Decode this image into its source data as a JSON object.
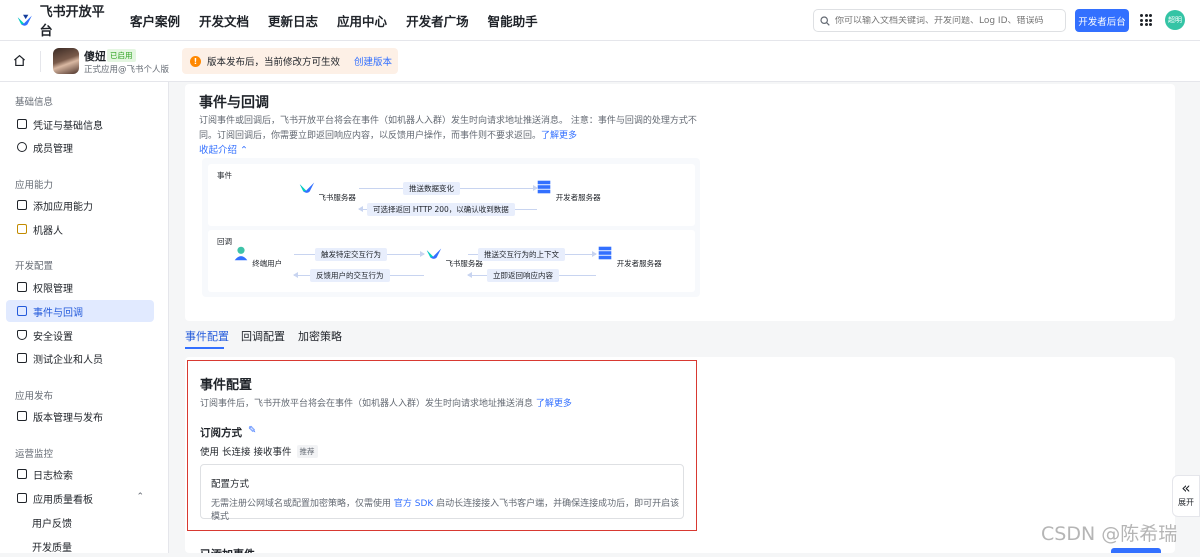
{
  "topnav": {
    "logo_text": "飞书开放平台",
    "links": [
      "客户案例",
      "开发文档",
      "更新日志",
      "应用中心",
      "开发者广场",
      "智能助手"
    ],
    "search_placeholder": "你可以输入文档关键词、开发问题、Log ID、错误码",
    "dev_button": "开发者后台",
    "avatar_text": "超明"
  },
  "app": {
    "name": "傻妞",
    "status": "已启用",
    "subtitle": "正式应用@飞书个人版"
  },
  "notice": {
    "text": "版本发布后，当前修改方可生效",
    "link": "创建版本"
  },
  "sidebar": {
    "sections": [
      {
        "title": "基础信息",
        "items": [
          {
            "label": "凭证与基础信息"
          },
          {
            "label": "成员管理"
          }
        ]
      },
      {
        "title": "应用能力",
        "items": [
          {
            "label": "添加应用能力"
          },
          {
            "label": "机器人"
          }
        ]
      },
      {
        "title": "开发配置",
        "items": [
          {
            "label": "权限管理"
          },
          {
            "label": "事件与回调"
          },
          {
            "label": "安全设置"
          },
          {
            "label": "测试企业和人员"
          }
        ]
      },
      {
        "title": "应用发布",
        "items": [
          {
            "label": "版本管理与发布"
          }
        ]
      },
      {
        "title": "运营监控",
        "items": [
          {
            "label": "日志检索"
          },
          {
            "label": "应用质量看板"
          },
          {
            "label": "用户反馈"
          },
          {
            "label": "开发质量"
          }
        ]
      }
    ]
  },
  "intro": {
    "title": "事件与回调",
    "desc": "订阅事件或回调后，飞书开放平台将会在事件（如机器人入群）发生时向请求地址推送消息。 注意：事件与回调的处理方式不同。订阅回调后，你需要立即返回响应内容，以反馈用户操作，而事件则不要求返回。",
    "learn_more": "了解更多",
    "collapse": "收起介绍"
  },
  "diagram": {
    "event": {
      "tag": "事件",
      "from": "飞书服务器",
      "to": "开发者服务器",
      "push": "推送数据变化",
      "reply": "可选择返回 HTTP 200，以确认收到数据"
    },
    "callback": {
      "tag": "回调",
      "user": "终端用户",
      "mid": "飞书服务器",
      "to": "开发者服务器",
      "trigger": "触发特定交互行为",
      "feedback": "反馈用户的交互行为",
      "push_ctx": "推送交互行为的上下文",
      "respond": "立即返回响应内容"
    }
  },
  "tabs": [
    "事件配置",
    "回调配置",
    "加密策略"
  ],
  "event_config": {
    "title": "事件配置",
    "desc": "订阅事件后，飞书开放平台将会在事件（如机器人入群）发生时向请求地址推送消息",
    "learn_more": "了解更多",
    "sub_title": "订阅方式",
    "use_prefix": "使用",
    "use_mode": "长连接",
    "use_suffix": "接收事件",
    "recommend": "推荐",
    "cfg_title": "配置方式",
    "cfg_desc_pre": "无需注册公网域名或配置加密策略，仅需使用",
    "cfg_link": "官方 SDK",
    "cfg_desc_post": "启动长连接接入飞书客户端，并确保连接成功后，即可开启该模式"
  },
  "next_title": "已添加事件",
  "expand_label": "展开",
  "watermark": "CSDN @陈希瑞"
}
